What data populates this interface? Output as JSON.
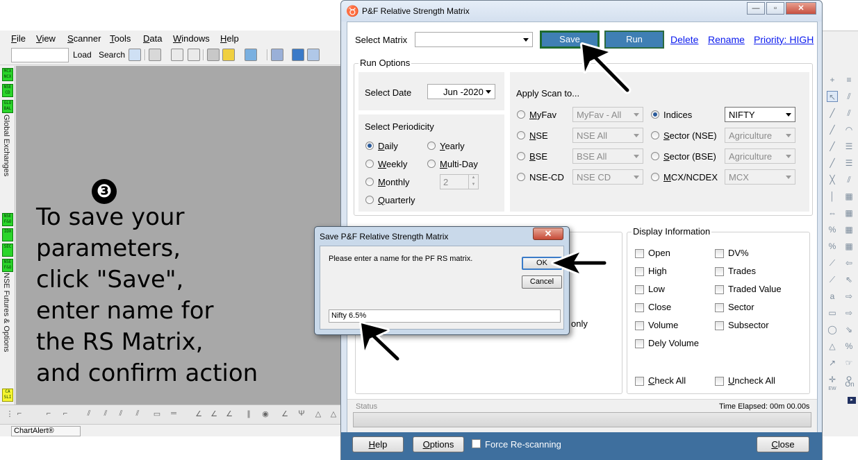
{
  "background_app": {
    "menu": [
      "File",
      "View",
      "Scanner",
      "Tools",
      "Data",
      "Windows",
      "Help"
    ],
    "toolbar": {
      "load_label": "Load",
      "search_label": "Search"
    },
    "left_buttons_top": [
      "MCX NCX",
      "NSE CD",
      "GLO BAL"
    ],
    "left_label_top": "Global Exchanges",
    "left_buttons_bottom": [
      "NSE F&O",
      "IDX",
      "SEC",
      "NSE F&O"
    ],
    "left_label_bottom": "NSE Futures & Options",
    "left_button_yellow": "CA SLI",
    "status_text": "ChartAlert®"
  },
  "instruction": {
    "step_number": "❸",
    "lines": [
      "To save your",
      "parameters,",
      "click \"Save\",",
      "enter name for",
      "the RS Matrix,",
      "and confirm action"
    ]
  },
  "pf_window": {
    "title": "P&F Relative Strength Matrix",
    "window_buttons": {
      "minimize": "—",
      "maximize": "▫",
      "close": "✕"
    },
    "select_matrix_label": "Select Matrix",
    "select_matrix_value": "",
    "save_label": "Save",
    "run_label": "Run",
    "links": {
      "delete": "Delete",
      "rename": "Rename",
      "priority": "Priority: HIGH"
    },
    "run_options": {
      "title": "Run Options",
      "select_date_label": "Select Date",
      "date_value": "Jun -2020",
      "periodicity_title": "Select Periodicity",
      "periodicity": [
        {
          "label": "Daily",
          "selected": true
        },
        {
          "label": "Yearly",
          "selected": false
        },
        {
          "label": "Weekly",
          "selected": false
        },
        {
          "label": "Multi-Day",
          "selected": false
        },
        {
          "label": "Monthly",
          "selected": false
        },
        {
          "label": "Quarterly",
          "selected": false
        }
      ],
      "multi_day_value": "2",
      "apply_scan_label": "Apply Scan to...",
      "scan_options": [
        {
          "label": "MyFav",
          "value": "MyFav - All",
          "selected": false,
          "enabled": false
        },
        {
          "label": "NSE",
          "value": "NSE All",
          "selected": false,
          "enabled": false
        },
        {
          "label": "BSE",
          "value": "BSE All",
          "selected": false,
          "enabled": false
        },
        {
          "label": "NSE-CD",
          "value": "NSE CD",
          "selected": false,
          "enabled": false
        },
        {
          "label": "Indices",
          "value": "NIFTY",
          "selected": true,
          "enabled": true
        },
        {
          "label": "Sector (NSE)",
          "value": "Agriculture",
          "selected": false,
          "enabled": false
        },
        {
          "label": "Sector (BSE)",
          "value": "Agriculture",
          "selected": false,
          "enabled": false
        },
        {
          "label": "MCX/NCDEX",
          "value": "MCX",
          "selected": false,
          "enabled": false
        }
      ]
    },
    "hidden_fragment": "only",
    "display_information": {
      "title": "Display Information",
      "items": [
        "Open",
        "High",
        "Low",
        "Close",
        "Volume",
        "Dely Volume",
        "DV%",
        "Trades",
        "Traded Value",
        "Sector",
        "Subsector"
      ],
      "check_all": "Check All",
      "uncheck_all": "Uncheck All"
    },
    "status_label": "Status",
    "time_elapsed": "Time Elapsed: 00m 00.00s",
    "footer": {
      "help": "Help",
      "options": "Options",
      "force_rescan": "Force Re-scanning",
      "close": "Close",
      "color": "#3e6f9e"
    }
  },
  "save_dialog": {
    "title": "Save P&F Relative Strength Matrix",
    "prompt": "Please enter a name for the PF RS matrix.",
    "ok_label": "OK",
    "cancel_label": "Cancel",
    "close_glyph": "✕",
    "input_value": "Nifty 6.5%"
  },
  "colors": {
    "accent_border": "#1e6a2e",
    "button_fill": "#3f7fb4",
    "link": "#0a1aee",
    "gray_canvas": "#a8a8a8"
  }
}
